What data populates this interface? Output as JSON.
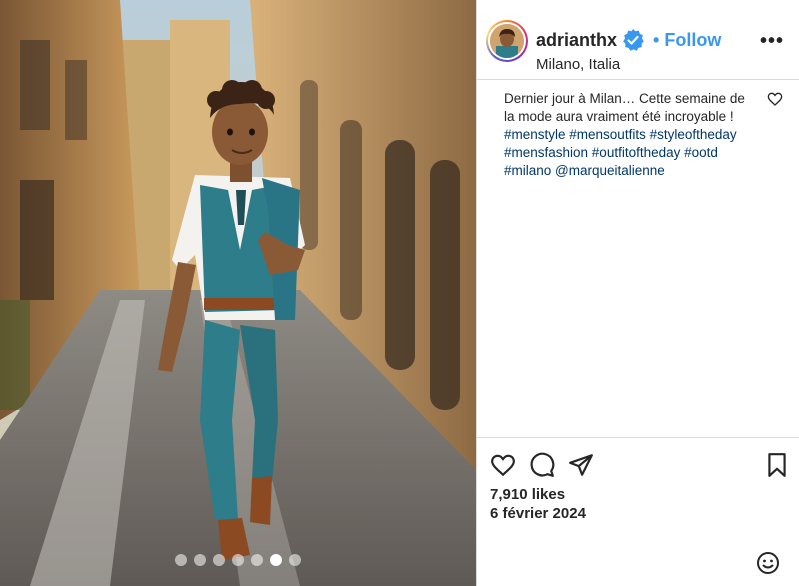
{
  "post": {
    "username": "adrianthx",
    "follow_label": "Follow",
    "location": "Milano, Italia",
    "more_label": "•••",
    "caption_text": "Dernier jour à Milan… Cette semaine de la mode aura vraiment été incroyable !",
    "caption_tags_line1": "#menstyle #mensoutfits #styleoftheday",
    "caption_tags_line2": "#mensfashion #outfitoftheday #ootd",
    "caption_tags_line3": "#milano @marqueitalienne",
    "likes": "7,910 likes",
    "date": "6 février 2024"
  },
  "carousel": {
    "count": 7,
    "active_index": 5
  },
  "colors": {
    "accent": "#3897f0",
    "verified": "#3897f0",
    "tag_link": "#00376b",
    "outfit": "#2e7d8a"
  },
  "icons": [
    "verified-badge-icon",
    "more-options-icon",
    "caption-like-icon",
    "like-icon",
    "comment-icon",
    "share-icon",
    "save-icon",
    "emoji-icon"
  ]
}
